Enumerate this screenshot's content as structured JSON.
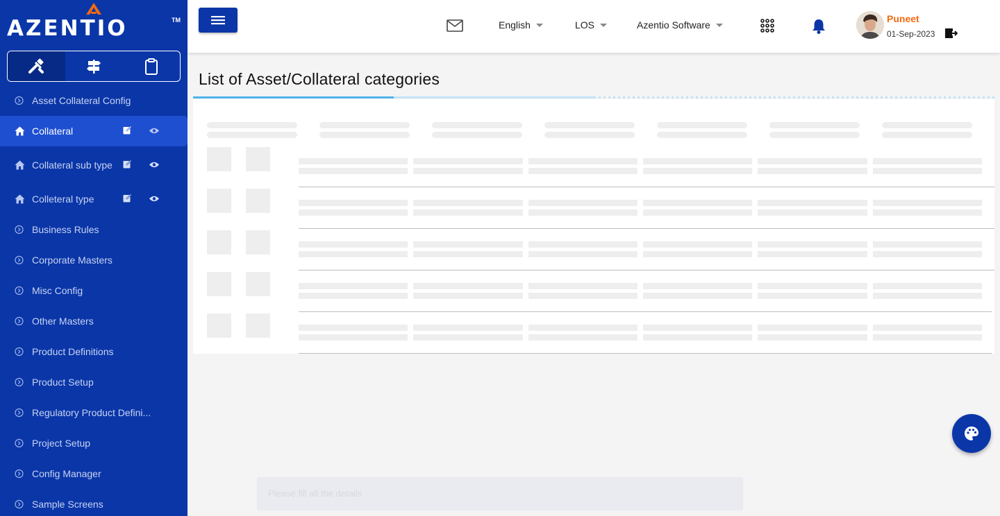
{
  "brand": {
    "name": "AZENTIO",
    "tm": "TM"
  },
  "sidebar": {
    "items": [
      {
        "label": "Asset Collateral Config"
      },
      {
        "label": "Collateral"
      },
      {
        "label": "Collateral sub type"
      },
      {
        "label": "Colleteral type"
      },
      {
        "label": "Business Rules"
      },
      {
        "label": "Corporate Masters"
      },
      {
        "label": "Misc Config"
      },
      {
        "label": "Other Masters"
      },
      {
        "label": "Product Definitions"
      },
      {
        "label": "Product Setup"
      },
      {
        "label": "Regulatory Product Defini..."
      },
      {
        "label": "Project Setup"
      },
      {
        "label": "Config Manager"
      },
      {
        "label": "Sample Screens"
      }
    ]
  },
  "header": {
    "language": "English",
    "module": "LOS",
    "company": "Azentio Software",
    "user_name": "Puneet",
    "date": "01-Sep-2023"
  },
  "main": {
    "title": "List of Asset/Collateral categories"
  },
  "toast": {
    "text": "Please fill all the details"
  },
  "colors": {
    "primary": "#0a36a8",
    "active": "#1e4fd1",
    "accent": "#f26a10",
    "progress": "#4fb3e8"
  }
}
